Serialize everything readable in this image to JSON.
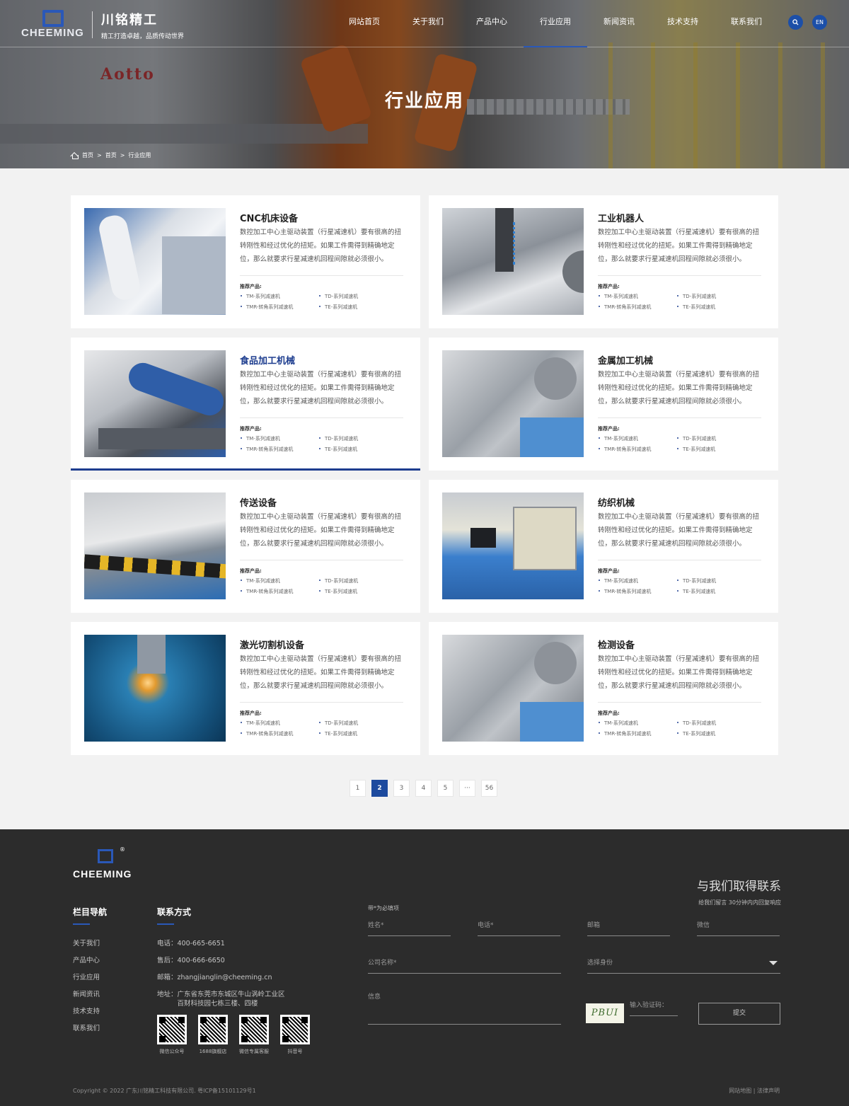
{
  "header": {
    "logo_text": "CHEEMING",
    "brand_cn": "川铭精工",
    "slogan": "精工打造卓越，品质传动世界",
    "nav": [
      "网站首页",
      "关于我们",
      "产品中心",
      "行业应用",
      "新闻资讯",
      "技术支持",
      "联系我们"
    ],
    "active_nav": "行业应用",
    "lang": "EN",
    "search_icon": "search-icon"
  },
  "hero": {
    "title": "行业应用",
    "backdrop_sign": "Aotto",
    "breadcrumb": [
      "首页",
      "首页",
      "行业应用"
    ],
    "breadcrumb_sep": ">"
  },
  "cards": [
    {
      "title": "CNC机床设备",
      "desc": "数控加工中心主驱动装置（行星减速机）要有很高的扭转刚性和经过优化的扭矩。如果工件需得到精确地定位，那么就要求行星减速机回程间隙就必须很小。",
      "rec": "推荐产品:",
      "products": [
        "TM-系列减速机",
        "TD-系列减速机",
        "TMR-转角系列减速机",
        "TE-系列减速机"
      ]
    },
    {
      "title": "工业机器人",
      "desc": "数控加工中心主驱动装置（行星减速机）要有很高的扭转刚性和经过优化的扭矩。如果工件需得到精确地定位，那么就要求行星减速机回程间隙就必须很小。",
      "rec": "推荐产品:",
      "products": [
        "TM-系列减速机",
        "TD-系列减速机",
        "TMR-转角系列减速机",
        "TE-系列减速机"
      ]
    },
    {
      "title": "食品加工机械",
      "desc": "数控加工中心主驱动装置（行星减速机）要有很高的扭转刚性和经过优化的扭矩。如果工件需得到精确地定位，那么就要求行星减速机回程间隙就必须很小。",
      "rec": "推荐产品:",
      "products": [
        "TM-系列减速机",
        "TD-系列减速机",
        "TMR-转角系列减速机",
        "TE-系列减速机"
      ]
    },
    {
      "title": "金属加工机械",
      "desc": "数控加工中心主驱动装置（行星减速机）要有很高的扭转刚性和经过优化的扭矩。如果工件需得到精确地定位，那么就要求行星减速机回程间隙就必须很小。",
      "rec": "推荐产品:",
      "products": [
        "TM-系列减速机",
        "TD-系列减速机",
        "TMR-转角系列减速机",
        "TE-系列减速机"
      ]
    },
    {
      "title": "传送设备",
      "desc": "数控加工中心主驱动装置（行星减速机）要有很高的扭转刚性和经过优化的扭矩。如果工件需得到精确地定位，那么就要求行星减速机回程间隙就必须很小。",
      "rec": "推荐产品:",
      "products": [
        "TM-系列减速机",
        "TD-系列减速机",
        "TMR-转角系列减速机",
        "TE-系列减速机"
      ]
    },
    {
      "title": "纺织机械",
      "desc": "数控加工中心主驱动装置（行星减速机）要有很高的扭转刚性和经过优化的扭矩。如果工件需得到精确地定位，那么就要求行星减速机回程间隙就必须很小。",
      "rec": "推荐产品:",
      "products": [
        "TM-系列减速机",
        "TD-系列减速机",
        "TMR-转角系列减速机",
        "TE-系列减速机"
      ]
    },
    {
      "title": "激光切割机设备",
      "desc": "数控加工中心主驱动装置（行星减速机）要有很高的扭转刚性和经过优化的扭矩。如果工件需得到精确地定位，那么就要求行星减速机回程间隙就必须很小。",
      "rec": "推荐产品:",
      "products": [
        "TM-系列减速机",
        "TD-系列减速机",
        "TMR-转角系列减速机",
        "TE-系列减速机"
      ]
    },
    {
      "title": "检测设备",
      "desc": "数控加工中心主驱动装置（行星减速机）要有很高的扭转刚性和经过优化的扭矩。如果工件需得到精确地定位，那么就要求行星减速机回程间隙就必须很小。",
      "rec": "推荐产品:",
      "products": [
        "TM-系列减速机",
        "TD-系列减速机",
        "TMR-转角系列减速机",
        "TE-系列减速机"
      ]
    }
  ],
  "pagination": {
    "pages": [
      "1",
      "2",
      "3",
      "4",
      "5",
      "···",
      "56"
    ],
    "current": "2"
  },
  "footer": {
    "logo_text": "CHEEMING",
    "reg_mark": "®",
    "nav_title": "栏目导航",
    "nav_items": [
      "关于我们",
      "产品中心",
      "行业应用",
      "新闻资讯",
      "技术支持",
      "联系我们"
    ],
    "contact_title": "联系方式",
    "phone": "电话：400-665-6651",
    "sales": "售后：400-666-6650",
    "email": "邮箱：zhangjianglin@cheeming.cn",
    "address_label": "地址：",
    "address_l1": "广东省东莞市东城区牛山涡岭工业区",
    "address_l2": "百财科技园七栋三楼、四楼",
    "qr_labels": [
      "微信公众号",
      "1688旗舰店",
      "微信专属客服",
      "抖音号"
    ],
    "contact_heading": "与我们取得联系",
    "contact_sub": "给我们留言 30分钟内内回复响应",
    "required_note": "带*为必填项",
    "form": {
      "name": "姓名*",
      "phone": "电话*",
      "email": "邮箱",
      "wechat": "微信",
      "company": "公司名称*",
      "identity": "选择身份",
      "message": "信息",
      "captcha_label": "输入验证码：",
      "captcha_text": "PBUI",
      "submit": "提交"
    },
    "copyright": "Copyright © 2022 广东川铭精工科技有限公司. 粤ICP备15101129号1",
    "links": "网站地图 | 法律声明"
  },
  "colors": {
    "accent": "#1d4a9e",
    "footer_bg": "#2c2c2c",
    "page_bg": "#f2f2f2"
  }
}
